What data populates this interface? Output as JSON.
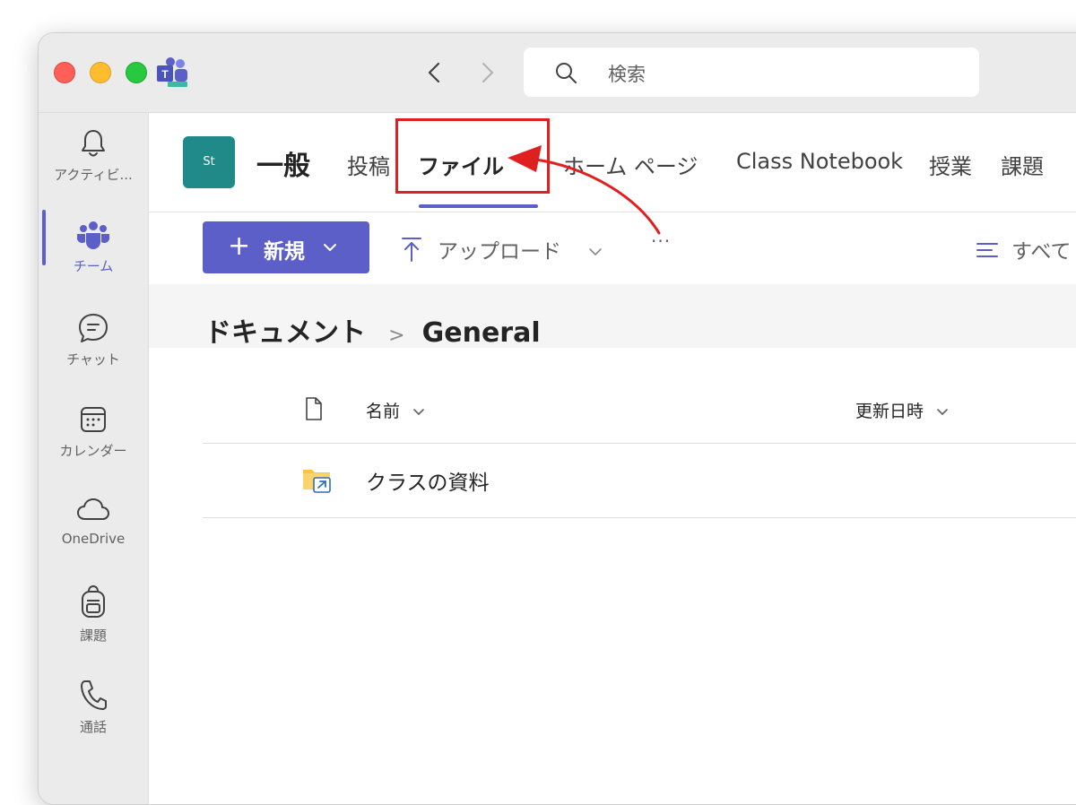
{
  "search": {
    "placeholder": "検索"
  },
  "rail": {
    "items": [
      {
        "label": "アクティビ...",
        "icon": "bell-icon"
      },
      {
        "label": "チーム",
        "icon": "teams-icon",
        "active": true
      },
      {
        "label": "チャット",
        "icon": "chat-icon"
      },
      {
        "label": "カレンダー",
        "icon": "calendar-icon"
      },
      {
        "label": "OneDrive",
        "icon": "cloud-icon"
      },
      {
        "label": "課題",
        "icon": "backpack-icon"
      },
      {
        "label": "通話",
        "icon": "phone-icon"
      }
    ]
  },
  "channel": {
    "avatar": "St",
    "name": "一般",
    "tabs": [
      {
        "label": "投稿"
      },
      {
        "label": "ファイル",
        "active": true
      },
      {
        "label": "ホーム ページ"
      },
      {
        "label": "Class Notebook"
      },
      {
        "label": "授業"
      },
      {
        "label": "課題"
      }
    ]
  },
  "toolbar": {
    "new_label": "新規",
    "upload_label": "アップロード",
    "more_label": "···",
    "filter_label": "すべて"
  },
  "breadcrumb": {
    "root": "ドキュメント",
    "separator": ">",
    "current": "General"
  },
  "list": {
    "columns": {
      "name": "名前",
      "modified": "更新日時"
    },
    "rows": [
      {
        "name": "クラスの資料",
        "icon": "shared-folder-icon"
      }
    ]
  },
  "colors": {
    "accent": "#5b5fc7",
    "annotation_red": "#e02020",
    "team_avatar": "#1f8a87"
  }
}
